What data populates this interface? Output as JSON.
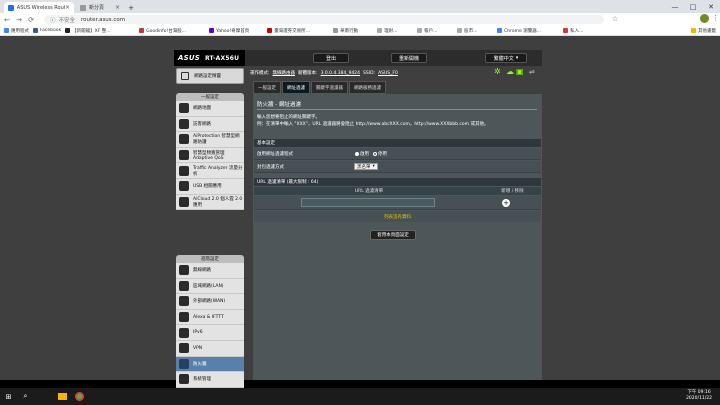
{
  "browser": {
    "tabs": [
      {
        "label": "ASUS Wireless Router RT-AX5...",
        "active": true
      },
      {
        "label": "新分頁",
        "active": false
      }
    ],
    "tab_new": "+",
    "win_min": "—",
    "win_max": "□",
    "win_close": "✕",
    "nav_back": "←",
    "nav_forward": "→",
    "nav_reload": "⟳",
    "not_secure": "不安全",
    "url": "router.asus.com",
    "bookmarks": [
      "應用程式",
      "Facebook",
      "【新聞龍】XF 整...",
      "Goodinfo!台灣股...",
      "Yahoo!奇摩首頁",
      "臺灣證券交易所...",
      "華南行動",
      "理財...",
      "帳戶...",
      "股市...",
      "Chrome 瀏覽器...",
      "私人..."
    ],
    "other_bookmarks": "其他書籤"
  },
  "router": {
    "brand": "ASUS",
    "model": "RT-AX56U",
    "top_buttons": {
      "logout": "登出",
      "reboot": "重新開機",
      "language": "繁體中文"
    },
    "status": {
      "mode_label": "運作模式:",
      "mode_value": "無線路由器",
      "firmware_label": "韌體版本:",
      "firmware_value": "3.0.0.4.384_9424",
      "ssid_label": "SSID:",
      "ssid_value": "ASUS_F0"
    },
    "quick_setup": "網路設定精靈",
    "general_title": "一般設定",
    "general_items": [
      "網路地圖",
      "訪客網路",
      "AiProtection 智慧型網路防護",
      "智慧型頻寬管理 Adaptive QoS",
      "Traffic Analyzer 流量分析",
      "USB 相關應用",
      "AiCloud 2.0 個人雲 2.0 應用"
    ],
    "advanced_title": "進階設定",
    "advanced_items": [
      "無線網路",
      "區域網路(LAN)",
      "外部網路(WAN)",
      "Alexa & IFTTT",
      "IPv6",
      "VPN",
      "防火牆",
      "系統管理"
    ],
    "selected_advanced": "防火牆",
    "subtabs": [
      "一般設定",
      "網址過濾",
      "關鍵字過濾器",
      "網路服務過濾"
    ],
    "selected_subtab": "網址過濾",
    "page_title": "防火牆 - 網址過濾",
    "description_line1": "輸入您想要阻止的網址關鍵字。",
    "description_line2": "例：在清單中輸入 \"XXX\"，URL 過濾器將會阻止 http://www.abcXXX.com，http://www.XXXbbb.com 或其他。",
    "basic_config_title": "基本設定",
    "enable_label": "啟用網址過濾程式",
    "enable_yes": "啟用",
    "enable_no": "停用",
    "enable_value": "停用",
    "filter_mode_label": "封包過濾方式",
    "filter_mode_value": "黑名單",
    "url_list_title": "URL 過濾清單 (最大限制 : 64)",
    "url_col": "URL 過濾清單",
    "action_col": "新增 / 移除",
    "url_input_value": "",
    "add_icon": "+",
    "no_data": "列表沒有資料",
    "apply_button": "套用本頁面設定"
  },
  "taskbar": {
    "start_icon": "⊞",
    "search_icon": "⌕",
    "time": "下午 09:16",
    "date": "2020/11/22"
  }
}
